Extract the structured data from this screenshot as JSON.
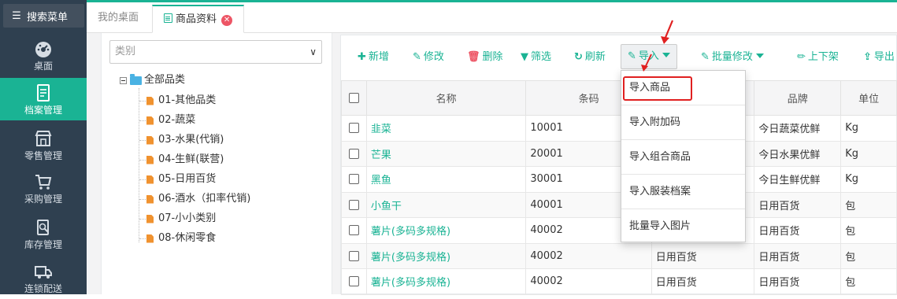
{
  "sidebar": {
    "search_label": "搜索菜单",
    "items": [
      {
        "label": "桌面",
        "icon": "dashboard-icon"
      },
      {
        "label": "档案管理",
        "icon": "archive-icon",
        "active": true
      },
      {
        "label": "零售管理",
        "icon": "store-icon"
      },
      {
        "label": "采购管理",
        "icon": "cart-icon"
      },
      {
        "label": "库存管理",
        "icon": "inventory-icon"
      },
      {
        "label": "连锁配送",
        "icon": "truck-icon"
      }
    ]
  },
  "tabs": [
    {
      "label": "我的桌面"
    },
    {
      "label": "商品资料",
      "active": true
    }
  ],
  "category": {
    "select_placeholder": "类别",
    "root": "全部品类",
    "items": [
      "01-其他品类",
      "02-蔬菜",
      "03-水果(代销)",
      "04-生鲜(联营)",
      "05-日用百货",
      "06-酒水（扣率代销)",
      "07-小小类别",
      "08-休闲零食"
    ]
  },
  "toolbar": {
    "add": "新增",
    "edit": "修改",
    "delete": "删除",
    "filter": "筛选",
    "refresh": "刷新",
    "import": "导入",
    "batch_edit": "批量修改",
    "shelf": "上下架",
    "export": "导出"
  },
  "import_menu": [
    "导入商品",
    "导入附加码",
    "导入组合商品",
    "导入服装档案",
    "批量导入图片"
  ],
  "table": {
    "columns": [
      "名称",
      "条码",
      "",
      "品牌",
      "单位"
    ],
    "rows": [
      {
        "name": "韭菜",
        "barcode": "10001",
        "category": "",
        "brand": "今日蔬菜优鲜",
        "unit": "Kg"
      },
      {
        "name": "芒果",
        "barcode": "20001",
        "category": "",
        "brand": "今日水果优鲜",
        "unit": "Kg"
      },
      {
        "name": "黑鱼",
        "barcode": "30001",
        "category": "",
        "brand": "今日生鲜优鲜",
        "unit": "Kg"
      },
      {
        "name": "小鱼干",
        "barcode": "40001",
        "category": "",
        "brand": "日用百货",
        "unit": "包"
      },
      {
        "name": "薯片(多码多规格)",
        "barcode": "40002",
        "category": "",
        "brand": "日用百货",
        "unit": "包"
      },
      {
        "name": "薯片(多码多规格)",
        "barcode": "40002",
        "category": "日用百货",
        "brand": "日用百货",
        "unit": "包"
      },
      {
        "name": "薯片(多码多规格)",
        "barcode": "40002",
        "category": "日用百货",
        "brand": "日用百货",
        "unit": "包"
      }
    ]
  },
  "colors": {
    "accent": "#1ab394",
    "sidebar": "#2f4050",
    "danger": "#ed5565",
    "highlight": "#e02020"
  }
}
